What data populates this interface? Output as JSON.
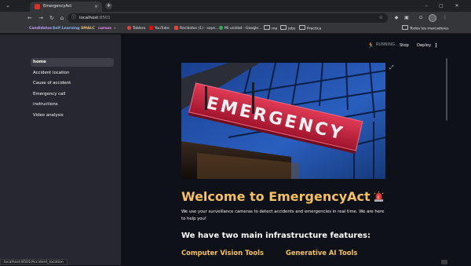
{
  "browser": {
    "tab_title": "EmergencyAct",
    "tab_close": "×",
    "new_tab": "+",
    "window_controls": [
      "–",
      "▢",
      "✕"
    ],
    "url_host": "localhost",
    "url_port": ":8501",
    "bookmarks": [
      {
        "label": "Candidatos",
        "color": "#c4a0ff"
      },
      {
        "label": "Self Learning",
        "color": "#8ab4f8"
      },
      {
        "label": "SMALC",
        "color": "#e8c070"
      },
      {
        "label": "cursos",
        "color": "#f28bff"
      },
      {
        "label": "»",
        "color": "#bdc1c6"
      },
      {
        "label": "Tablero",
        "color": "#ea4335"
      },
      {
        "label": "YouTube",
        "color": "#ff0000"
      },
      {
        "label": "Recibidos (1) - soye...",
        "color": "#ea4335"
      },
      {
        "label": "Mi unidad - Google...",
        "color": "#34a853"
      },
      {
        "label": "ma",
        "folder": true
      },
      {
        "label": "jobs",
        "folder": true
      },
      {
        "label": "Practica",
        "folder": true
      },
      {
        "label": "Todos los marcadores",
        "folder": true
      }
    ]
  },
  "sidebar": {
    "items": [
      {
        "label": "home",
        "active": true
      },
      {
        "label": "Accident location",
        "active": false
      },
      {
        "label": "Cause of accident",
        "active": false
      },
      {
        "label": "Emergency call",
        "active": false
      },
      {
        "label": "instructions",
        "active": false
      },
      {
        "label": "Video analysis",
        "active": false
      }
    ]
  },
  "status_url": "localhost:8501/Accident_location",
  "topbar": {
    "running": "RUNNING...",
    "stop": "Stop",
    "deploy": "Deploy",
    "more": "⋮"
  },
  "hero": {
    "sign_text": "EMERGENCY"
  },
  "main": {
    "title": "Welcome to EmergencyAct",
    "intro": "We use your surveillance cameras to detect accidents and emergencies in real time. We are here to help you!",
    "features_heading": "We have two main infrastructure features:",
    "feature_1": "Computer Vision Tools",
    "feature_2": "Generative AI Tools"
  },
  "colors": {
    "accent": "#f5c15f",
    "sidebar_bg": "#262730",
    "app_bg": "#0e1117",
    "sign_red": "#c8203a"
  }
}
